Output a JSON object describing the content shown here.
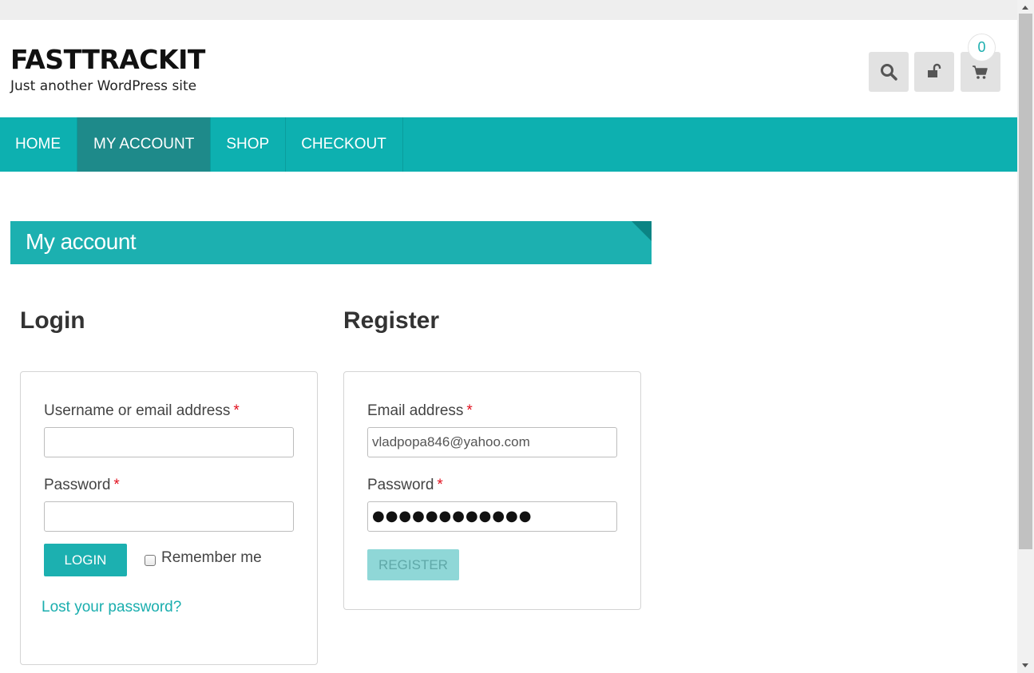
{
  "site": {
    "title": "FASTTRACKIT",
    "tagline": "Just another WordPress site"
  },
  "header_icons": {
    "search": "search-icon",
    "lock": "unlock-icon",
    "cart": "cart-icon",
    "cart_count": "0"
  },
  "nav": {
    "items": [
      {
        "label": "HOME"
      },
      {
        "label": "MY ACCOUNT",
        "active": true
      },
      {
        "label": "SHOP"
      },
      {
        "label": "CHECKOUT"
      }
    ]
  },
  "page": {
    "heading": "My account"
  },
  "login": {
    "title": "Login",
    "username_label": "Username or email address",
    "username_value": "",
    "password_label": "Password",
    "password_value": "",
    "required_mark": "*",
    "submit_label": "LOGIN",
    "remember_label": "Remember me",
    "remember_checked": false,
    "lost_password": "Lost your password?"
  },
  "register": {
    "title": "Register",
    "email_label": "Email address",
    "email_value": "vladpopa846@yahoo.com",
    "password_label": "Password",
    "password_mask": "●●●●●●●●●●●●",
    "required_mark": "*",
    "submit_label": "REGISTER",
    "submit_disabled": true
  },
  "colors": {
    "accent": "#0db0b0",
    "nav_active": "#1e8a8a",
    "heading_bar": "#1cb0b0",
    "required": "#e2101e",
    "link": "#1aaeae"
  }
}
